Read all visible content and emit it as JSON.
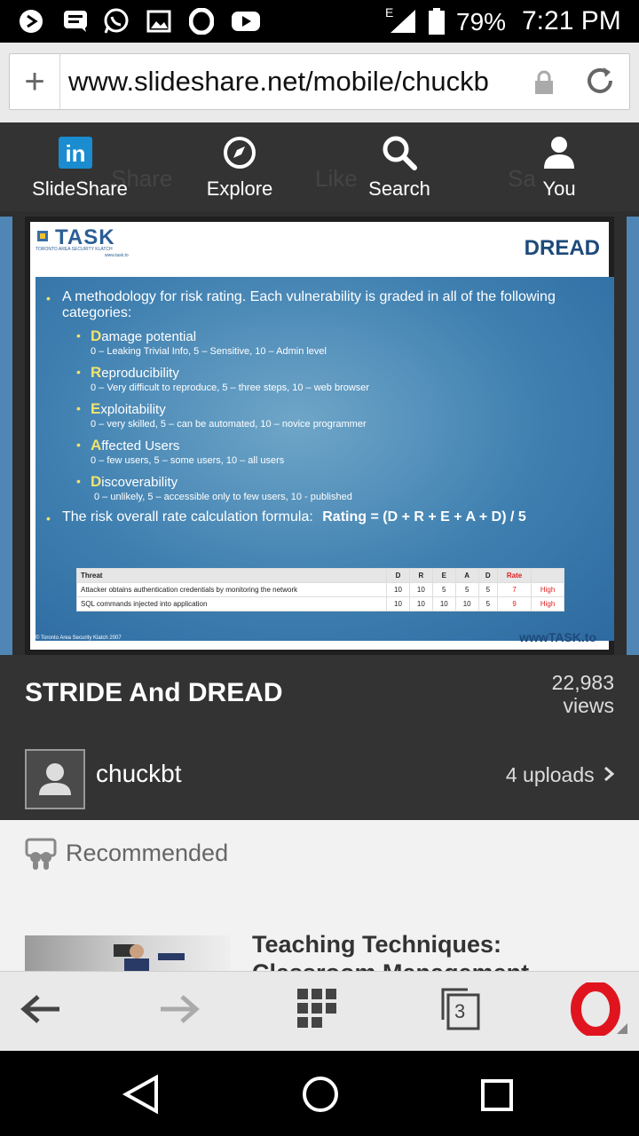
{
  "status_bar": {
    "battery": "79%",
    "time": "7:21 PM",
    "network": "E",
    "icons": [
      "play-circle-icon",
      "message-icon",
      "whatsapp-icon",
      "image-icon",
      "opera-icon",
      "youtube-icon",
      "signal-icon",
      "battery-icon"
    ]
  },
  "address_bar": {
    "url": "www.slideshare.net/mobile/chuckb",
    "plus": "+"
  },
  "site_nav": {
    "items": [
      {
        "label": "SlideShare",
        "icon": "linkedin-icon"
      },
      {
        "label": "Explore",
        "icon": "compass-icon"
      },
      {
        "label": "Search",
        "icon": "search-icon"
      },
      {
        "label": "You",
        "icon": "user-icon"
      }
    ],
    "ghost_items": [
      "Share",
      "Like",
      "Sa"
    ]
  },
  "slide": {
    "logo_text": "TASK",
    "logo_sub": "TORONTO AREA SECURITY KLATCH",
    "logo_url": "www.task.to",
    "title": "DREAD",
    "intro": "A methodology for risk rating. Each vulnerability is graded in all of the following categories:",
    "categories": [
      {
        "letter": "D",
        "rest": "amage potential",
        "detail": "0 – Leaking Trivial Info, 5 – Sensitive, 10 – Admin level"
      },
      {
        "letter": "R",
        "rest": "eproducibility",
        "detail": "0 – Very difficult to reproduce, 5 – three steps, 10 – web browser"
      },
      {
        "letter": "E",
        "rest": "xploitability",
        "detail": "0 – very skilled, 5 – can be automated, 10 – novice programmer"
      },
      {
        "letter": "A",
        "rest": "ffected Users",
        "detail": "0 – few users, 5 – some users, 10 – all users"
      },
      {
        "letter": "D",
        "rest": "iscoverability",
        "detail": "0 – unlikely, 5 – accessible only to few users, 10 - published"
      }
    ],
    "formula_label": "The risk overall rate calculation formula:",
    "formula": "Rating = (D + R + E + A + D) / 5",
    "table": {
      "headers": [
        "Threat",
        "D",
        "R",
        "E",
        "A",
        "D",
        "Rate",
        ""
      ],
      "rows": [
        [
          "Attacker obtains authentication credentials by monitoring the network",
          "10",
          "10",
          "5",
          "5",
          "5",
          "7",
          "High"
        ],
        [
          "SQL commands injected into application",
          "10",
          "10",
          "10",
          "10",
          "5",
          "9",
          "High"
        ]
      ]
    },
    "footer_left": "© Toronto Area Security Klatch 2007",
    "footer_right": "wwwTASK.to"
  },
  "info": {
    "title": "STRIDE And DREAD",
    "views_count": "22,983",
    "views_label": "views",
    "author": "chuckbt",
    "uploads": "4 uploads"
  },
  "recommended": {
    "label": "Recommended",
    "first_title": "Teaching Techniques: Classroom Management"
  },
  "browser_bar": {
    "tabs_count": "3"
  },
  "colors": {
    "header_bg": "#333333",
    "slide_blue": "#3e7fb0",
    "accent_yellow": "#f2e36a",
    "opera_red": "#e0141e"
  }
}
